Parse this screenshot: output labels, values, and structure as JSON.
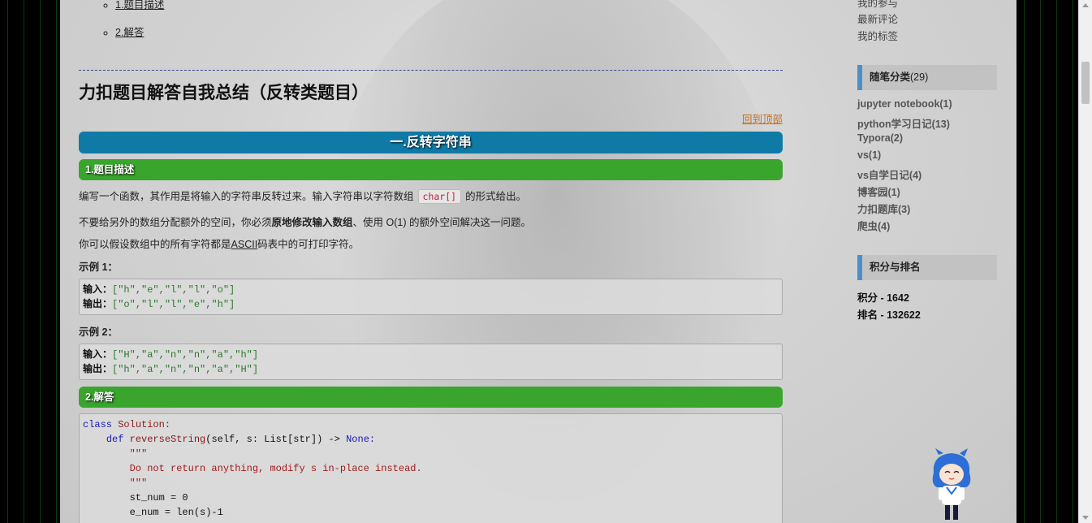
{
  "toc": [
    {
      "label": "1.题目描述"
    },
    {
      "label": "2.解答"
    }
  ],
  "post": {
    "title": "力扣题目解答自我总结（反转类题目）",
    "back_to_top": "回到顶部",
    "section1_title": "一.反转字符串",
    "sub1_title": "1.题目描述",
    "p1_before": "编写一个函数，其作用是将输入的字符串反转过来。输入字符串以字符数组",
    "p1_code": "char[]",
    "p1_after": "的形式给出。",
    "p2_before": "不要给另外的数组分配额外的空间，你必须",
    "p2_bold": "原地修改输入数组",
    "p2_after": "、使用 O(1) 的额外空间解决这一问题。",
    "p3_before": "你可以假设数组中的所有字符都是",
    "p3_link": "ASCII",
    "p3_after": "码表中的可打印字符。",
    "example1_label": "示例 1：",
    "example1_in_label": "输入：",
    "example1_in": "[\"h\",\"e\",\"l\",\"l\",\"o\"]",
    "example1_out_label": "输出：",
    "example1_out": "[\"o\",\"l\",\"l\",\"e\",\"h\"]",
    "example2_label": "示例 2：",
    "example2_in_label": "输入：",
    "example2_in": "[\"H\",\"a\",\"n\",\"n\",\"a\",\"h\"]",
    "example2_out_label": "输出：",
    "example2_out": "[\"h\",\"a\",\"n\",\"n\",\"a\",\"H\"]",
    "sub2_title": "2.解答",
    "code": {
      "l1_kw": "class",
      "l1_name": "Solution:",
      "l2_kw": "def",
      "l2_fn": "reverseString",
      "l2_rest": "(self, s: List[str]) ->",
      "l2_ret": "None:",
      "l3": "\"\"\"",
      "l4": "Do not return anything, modify s in-place instead.",
      "l5": "\"\"\"",
      "l6": "st_num = 0",
      "l7": "e_num = len(s)-1"
    }
  },
  "sidebar": {
    "top_links": [
      "我的参与",
      "最新评论",
      "我的标签"
    ],
    "categories_head": "随笔分类",
    "categories_count": "(29)",
    "categories": [
      "jupyter notebook(1)",
      "python学习日记(13)",
      "Typora(2)",
      "vs(1)",
      "vs自学日记(4)",
      "博客园(1)",
      "力扣题库(3)",
      "爬虫(4)"
    ],
    "rank_head": "积分与排名",
    "score": "积分 - 1642",
    "rank": "排名 - 132622"
  }
}
